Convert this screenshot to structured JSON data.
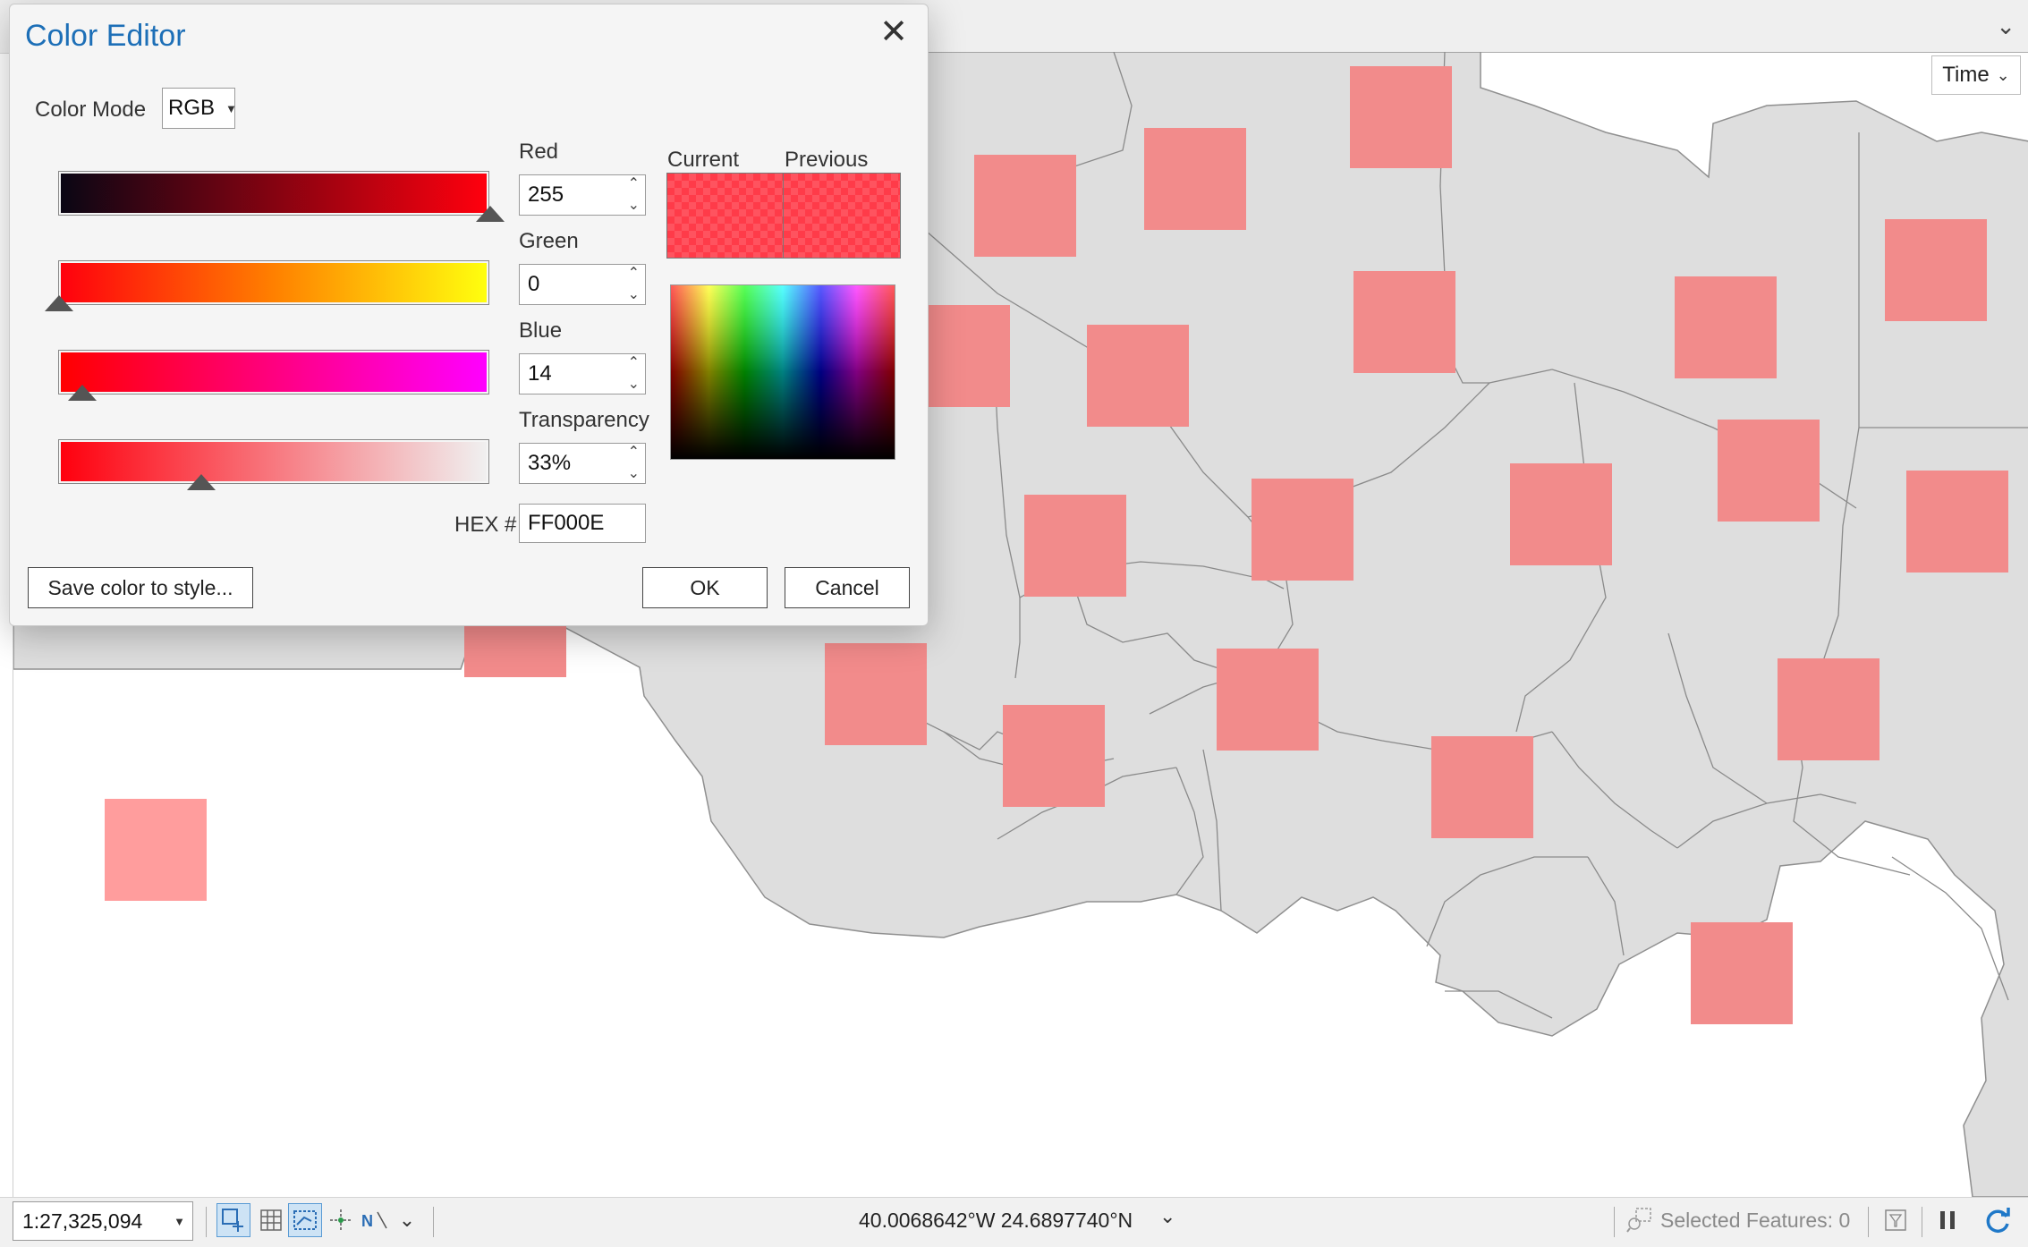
{
  "dialog": {
    "title": "Color Editor",
    "color_mode_label": "Color Mode",
    "color_mode_value": "RGB",
    "red_label": "Red",
    "red_value": "255",
    "green_label": "Green",
    "green_value": "0",
    "blue_label": "Blue",
    "blue_value": "14",
    "transparency_label": "Transparency",
    "transparency_value": "33%",
    "hex_label": "HEX #",
    "hex_value": "FF000E",
    "current_label": "Current",
    "previous_label": "Previous",
    "save_label": "Save color to style...",
    "ok_label": "OK",
    "cancel_label": "Cancel"
  },
  "map": {
    "time_label": "Time",
    "symbol_color": "#f28b8b"
  },
  "statusbar": {
    "scale": "1:27,325,094",
    "coordinates": "40.0068642°W 24.6897740°N",
    "selected_features": "Selected Features: 0"
  },
  "icons": [
    "close-icon",
    "dropdown-caret-icon",
    "chevron-down-icon",
    "snapping-icon",
    "grid-icon",
    "constraints-icon",
    "correction-icon",
    "north-arrow-icon",
    "select-features-icon",
    "filter-icon",
    "pause-icon",
    "refresh-icon"
  ]
}
